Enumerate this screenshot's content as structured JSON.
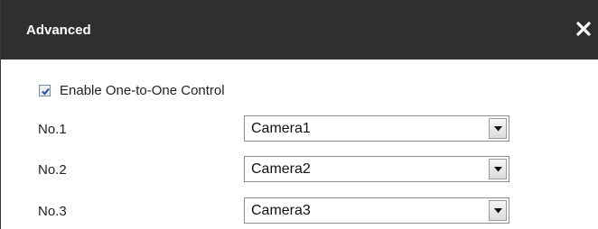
{
  "dialog": {
    "title": "Advanced",
    "close_icon": "close-icon",
    "colors": {
      "titlebar": "#2f2f2f",
      "title_text": "#ffffff"
    }
  },
  "enable": {
    "label": "Enable One-to-One Control",
    "checked": true
  },
  "rows": [
    {
      "label": "No.1",
      "value": "Camera1"
    },
    {
      "label": "No.2",
      "value": "Camera2"
    },
    {
      "label": "No.3",
      "value": "Camera3"
    }
  ]
}
